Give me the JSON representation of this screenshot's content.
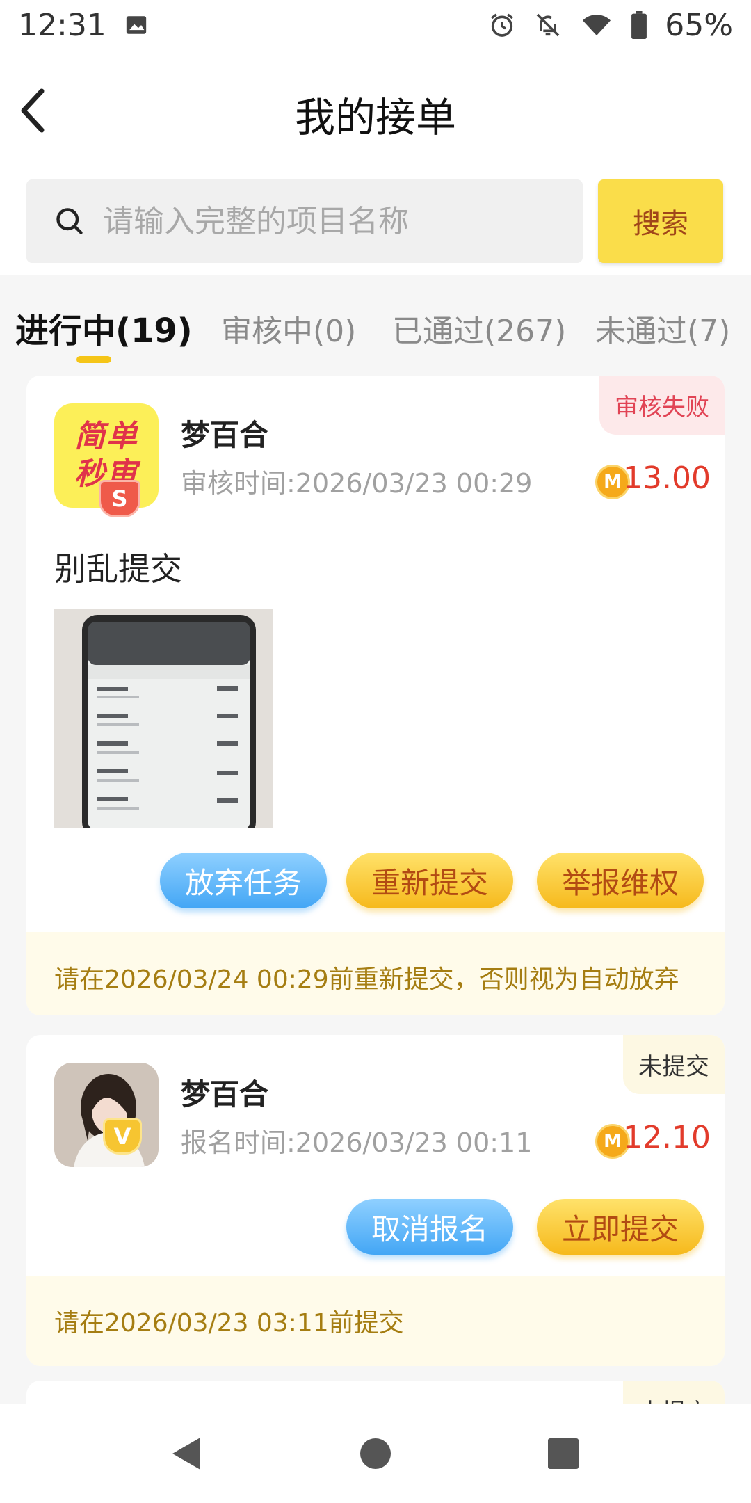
{
  "status_bar": {
    "time": "12:31",
    "battery": "65%"
  },
  "header": {
    "title": "我的接单"
  },
  "search": {
    "placeholder": "请输入完整的项目名称",
    "button": "搜索"
  },
  "tabs": [
    {
      "label": "进行中(19)",
      "active": true
    },
    {
      "label": "审核中(0)",
      "active": false
    },
    {
      "label": "已通过(267)",
      "active": false
    },
    {
      "label": "未通过(7)",
      "active": false
    }
  ],
  "cards": [
    {
      "badge": "审核失败",
      "logo_text": [
        "简单",
        "秒审"
      ],
      "level_badge": "S",
      "name": "梦百合",
      "time": "审核时间:2026/03/23 00:29",
      "coin": "M",
      "reward": "13.00",
      "description": "别乱提交",
      "buttons": [
        "放弃任务",
        "重新提交",
        "举报维权"
      ],
      "notice": "请在2026/03/24 00:29前重新提交，否则视为自动放弃"
    },
    {
      "badge": "未提交",
      "level_badge": "V",
      "name": "梦百合",
      "time": "报名时间:2026/03/23 00:11",
      "coin": "M",
      "reward": "12.10",
      "buttons": [
        "取消报名",
        "立即提交"
      ],
      "notice": "请在2026/03/23 03:11前提交"
    }
  ],
  "card3_badge": "未提交",
  "colors": {
    "accent": "#f5c518",
    "reward": "#e23b2b",
    "notice_text": "#a57d12"
  }
}
